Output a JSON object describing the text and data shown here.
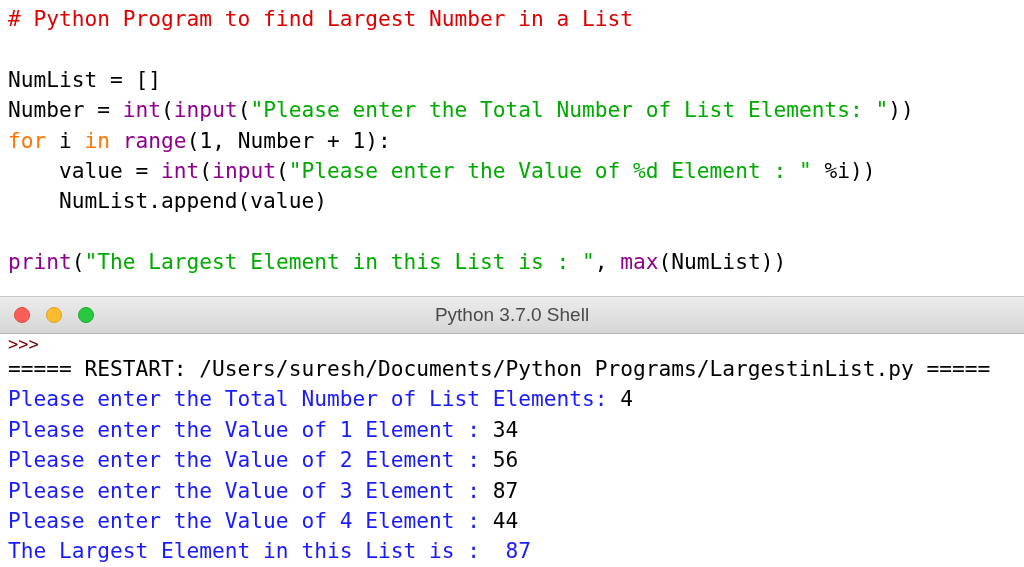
{
  "editor": {
    "lines": [
      {
        "kind": "code",
        "tokens": [
          {
            "kind": "comment",
            "text": "# Python Program to find Largest Number in a List"
          }
        ]
      },
      {
        "kind": "blank"
      },
      {
        "kind": "code",
        "tokens": [
          {
            "kind": "plain",
            "text": "NumList = []"
          }
        ]
      },
      {
        "kind": "code",
        "tokens": [
          {
            "kind": "plain",
            "text": "Number = "
          },
          {
            "kind": "builtin",
            "text": "int"
          },
          {
            "kind": "plain",
            "text": "("
          },
          {
            "kind": "builtin",
            "text": "input"
          },
          {
            "kind": "plain",
            "text": "("
          },
          {
            "kind": "string",
            "text": "\"Please enter the Total Number of List Elements: \""
          },
          {
            "kind": "plain",
            "text": "))"
          }
        ]
      },
      {
        "kind": "code",
        "tokens": [
          {
            "kind": "keyword",
            "text": "for"
          },
          {
            "kind": "plain",
            "text": " i "
          },
          {
            "kind": "keyword",
            "text": "in"
          },
          {
            "kind": "builtin",
            "text": " range"
          },
          {
            "kind": "plain",
            "text": "(1, Number + 1):"
          }
        ]
      },
      {
        "kind": "code",
        "tokens": [
          {
            "kind": "plain",
            "text": "    value = "
          },
          {
            "kind": "builtin",
            "text": "int"
          },
          {
            "kind": "plain",
            "text": "("
          },
          {
            "kind": "builtin",
            "text": "input"
          },
          {
            "kind": "plain",
            "text": "("
          },
          {
            "kind": "string",
            "text": "\"Please enter the Value of %d Element : \""
          },
          {
            "kind": "plain",
            "text": " %i))"
          }
        ]
      },
      {
        "kind": "code",
        "tokens": [
          {
            "kind": "plain",
            "text": "    NumList.append(value)"
          }
        ]
      },
      {
        "kind": "blank"
      },
      {
        "kind": "code",
        "tokens": [
          {
            "kind": "builtin",
            "text": "print"
          },
          {
            "kind": "plain",
            "text": "("
          },
          {
            "kind": "string",
            "text": "\"The Largest Element in this List is : \""
          },
          {
            "kind": "plain",
            "text": ", "
          },
          {
            "kind": "builtin",
            "text": "max"
          },
          {
            "kind": "plain",
            "text": "(NumList))"
          }
        ]
      }
    ]
  },
  "shell": {
    "title": "Python 3.7.0 Shell",
    "lines": [
      {
        "kind": "prompt",
        "text": ">>>"
      },
      {
        "kind": "restart",
        "text": "===== RESTART: /Users/suresh/Documents/Python Programs/LargestinList.py ====="
      },
      {
        "kind": "io",
        "output": "Please enter the Total Number of List Elements: ",
        "input": "4"
      },
      {
        "kind": "io",
        "output": "Please enter the Value of 1 Element : ",
        "input": "34"
      },
      {
        "kind": "io",
        "output": "Please enter the Value of 2 Element : ",
        "input": "56"
      },
      {
        "kind": "io",
        "output": "Please enter the Value of 3 Element : ",
        "input": "87"
      },
      {
        "kind": "io",
        "output": "Please enter the Value of 4 Element : ",
        "input": "44"
      },
      {
        "kind": "output",
        "text": "The Largest Element in this List is :  87"
      }
    ]
  }
}
